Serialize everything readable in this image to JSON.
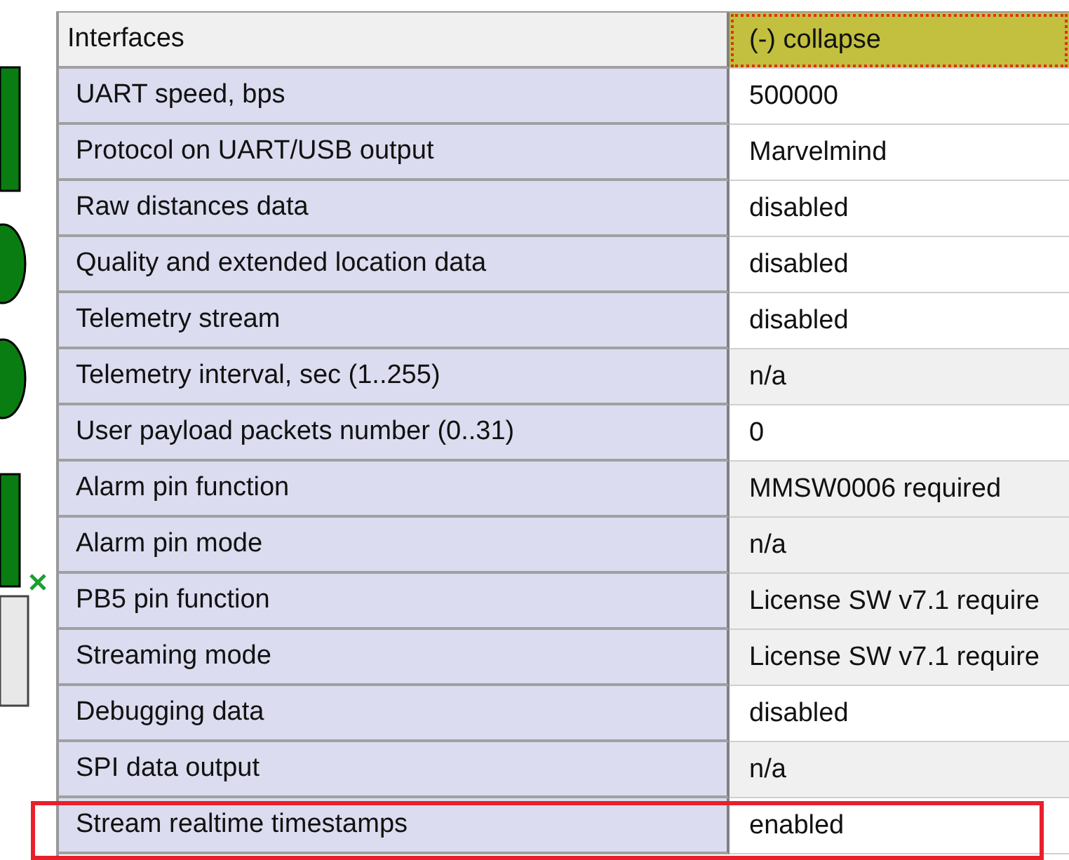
{
  "header": {
    "label": "Interfaces",
    "action": "(-) collapse",
    "focused": true
  },
  "rows": [
    {
      "label": "UART speed, bps",
      "value": "500000",
      "editable": true,
      "highlighted": false
    },
    {
      "label": "Protocol on UART/USB output",
      "value": "Marvelmind",
      "editable": true,
      "highlighted": false
    },
    {
      "label": "Raw distances data",
      "value": "disabled",
      "editable": true,
      "highlighted": false
    },
    {
      "label": "Quality and extended location data",
      "value": "disabled",
      "editable": true,
      "highlighted": false
    },
    {
      "label": "Telemetry stream",
      "value": "disabled",
      "editable": true,
      "highlighted": false
    },
    {
      "label": "Telemetry interval, sec (1..255)",
      "value": "n/a",
      "editable": false,
      "highlighted": false
    },
    {
      "label": "User payload packets number (0..31)",
      "value": "0",
      "editable": true,
      "highlighted": false
    },
    {
      "label": "Alarm pin function",
      "value": "MMSW0006 required",
      "editable": false,
      "highlighted": false
    },
    {
      "label": "Alarm pin mode",
      "value": "n/a",
      "editable": false,
      "highlighted": false
    },
    {
      "label": "PB5 pin function",
      "value": "License SW v7.1 require",
      "editable": false,
      "highlighted": false
    },
    {
      "label": "Streaming mode",
      "value": "License SW v7.1 require",
      "editable": false,
      "highlighted": false
    },
    {
      "label": "Debugging data",
      "value": "disabled",
      "editable": true,
      "highlighted": false
    },
    {
      "label": "SPI data output",
      "value": "n/a",
      "editable": false,
      "highlighted": false
    },
    {
      "label": "Stream realtime timestamps",
      "value": "enabled",
      "editable": true,
      "highlighted": true
    }
  ]
}
